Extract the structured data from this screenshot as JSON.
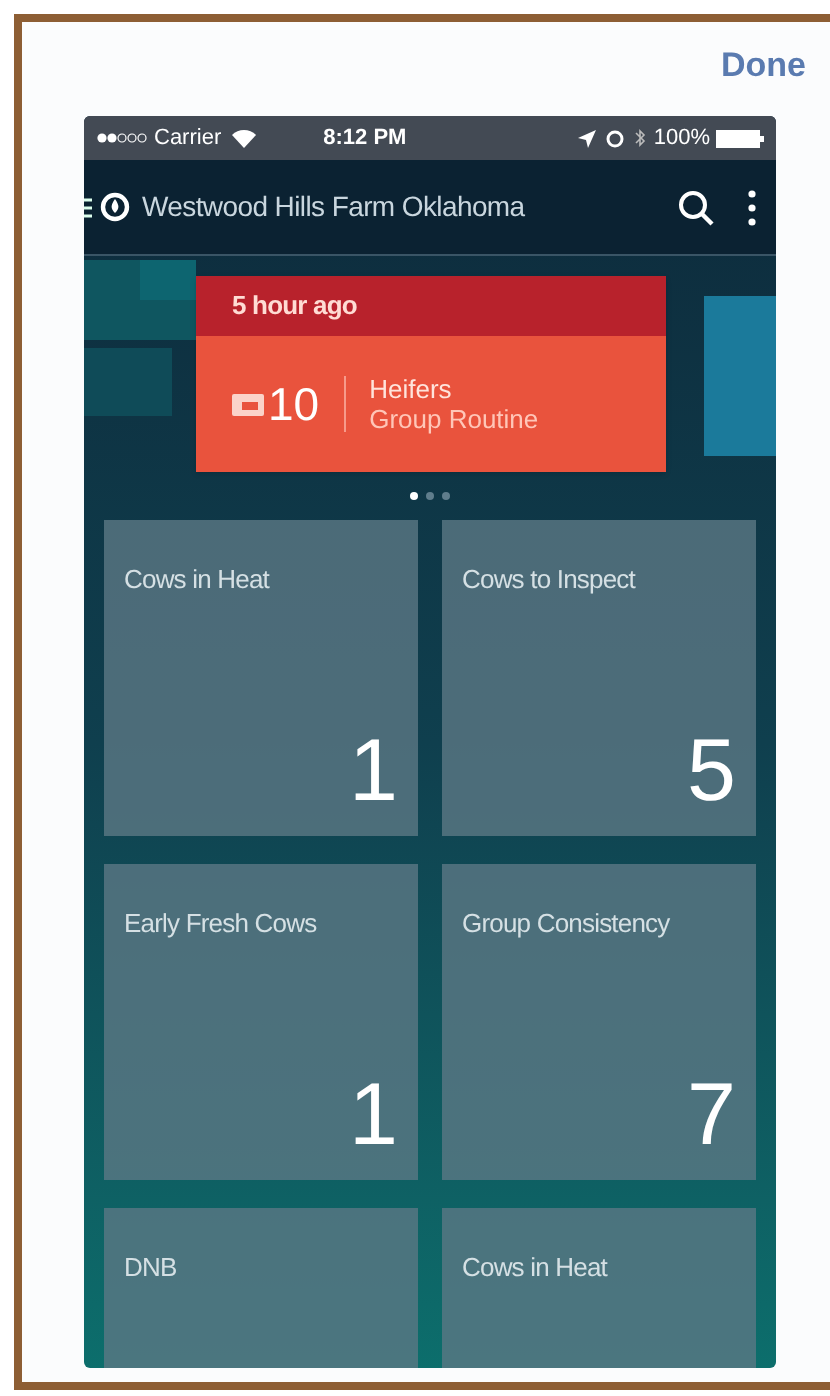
{
  "done_button": "Done",
  "status_bar": {
    "carrier": "Carrier",
    "time": "8:12 PM",
    "battery": "100%"
  },
  "app_bar": {
    "title": "Westwood Hills Farm Oklahoma"
  },
  "alert_card": {
    "time": "5 hour ago",
    "count": "10",
    "title": "Heifers",
    "subtitle": "Group Routine"
  },
  "pager": [
    {
      "selected": true
    },
    {
      "selected": false
    },
    {
      "selected": false
    }
  ],
  "tiles": [
    {
      "label": "Cows in Heat",
      "value": "1"
    },
    {
      "label": "Cows to Inspect",
      "value": "5"
    },
    {
      "label": "Early Fresh Cows",
      "value": "1"
    },
    {
      "label": "Group Consistency",
      "value": "7"
    },
    {
      "label": "DNB"
    },
    {
      "label": "Cows in Heat"
    }
  ]
}
